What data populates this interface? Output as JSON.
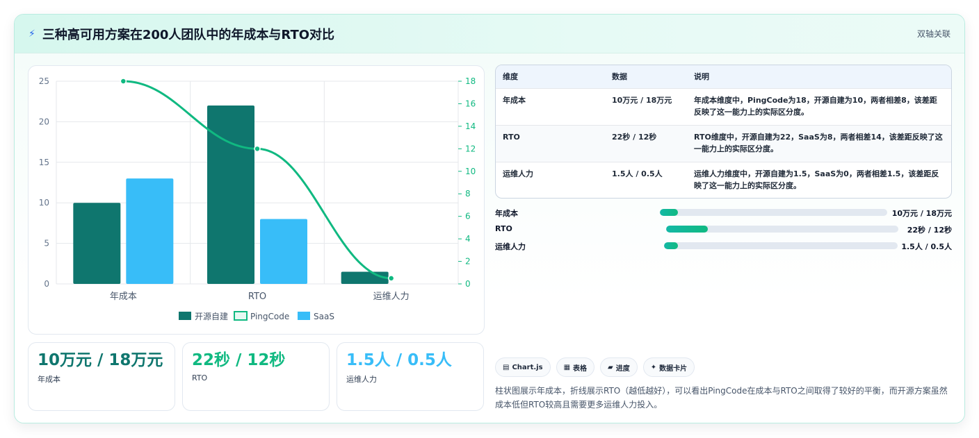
{
  "header": {
    "icon": "lightning-icon",
    "title": "三种高可用方案在200人团队中的年成本与RTO对比",
    "link": "双轴关联"
  },
  "colors": {
    "open_source": "#0f766e",
    "pingcode": "#10b981",
    "saas": "#38bdf8"
  },
  "chart_data": {
    "type": "bar",
    "categories": [
      "年成本",
      "RTO",
      "运维人力"
    ],
    "series": [
      {
        "name": "开源自建",
        "kind": "bar",
        "axis": "left",
        "values": [
          10,
          22,
          1.5
        ]
      },
      {
        "name": "PingCode",
        "kind": "line",
        "axis": "right",
        "values": [
          18,
          12,
          0.5
        ]
      },
      {
        "name": "SaaS",
        "kind": "bar",
        "axis": "left",
        "values": [
          13,
          8,
          0
        ]
      }
    ],
    "y_left": {
      "range": [
        0,
        25
      ],
      "ticks": [
        "0",
        "5",
        "10",
        "15",
        "20",
        "25"
      ]
    },
    "y_right": {
      "range": [
        0,
        18
      ],
      "ticks": [
        "0",
        "2",
        "4",
        "6",
        "8",
        "10",
        "12",
        "14",
        "16",
        "18"
      ]
    },
    "grid": true,
    "legend": "bottom"
  },
  "table": {
    "headers": [
      "维度",
      "数据",
      "说明"
    ],
    "rows": [
      {
        "dim": "年成本",
        "data": "10万元 / 18万元",
        "note": "年成本维度中，PingCode为18，开源自建为10，两者相差8，该差距反映了这一能力上的实际区分度。"
      },
      {
        "dim": "RTO",
        "data": "22秒 / 12秒",
        "note": "RTO维度中，开源自建为22，SaaS为8，两者相差14，该差距反映了这一能力上的实际区分度。"
      },
      {
        "dim": "运维人力",
        "data": "1.5人 / 0.5人",
        "note": "运维人力维度中，开源自建为1.5，SaaS为0，两者相差1.5，该差距反映了这一能力上的实际区分度。"
      }
    ]
  },
  "progress": [
    {
      "label": "年成本",
      "value": "10万元 / 18万元",
      "fill": 0.08
    },
    {
      "label": "RTO",
      "value": "22秒 / 12秒",
      "fill": 0.18
    },
    {
      "label": "运维人力",
      "value": "1.5人 / 0.5人",
      "fill": 0.06
    }
  ],
  "stats": [
    {
      "value": "10万元 / 18万元",
      "label": "年成本",
      "color": "#0f766e"
    },
    {
      "value": "22秒 / 12秒",
      "label": "RTO",
      "color": "#10b981"
    },
    {
      "value": "1.5人 / 0.5人",
      "label": "运维人力",
      "color": "#38bdf8"
    }
  ],
  "tags": [
    {
      "icon": "chart-icon",
      "glyph": "▤",
      "label": "Chart.js"
    },
    {
      "icon": "table-icon",
      "glyph": "▦",
      "label": "表格"
    },
    {
      "icon": "progress-icon",
      "glyph": "▰",
      "label": "进度"
    },
    {
      "icon": "sparkle-icon",
      "glyph": "✦",
      "label": "数据卡片"
    }
  ],
  "description": "柱状图展示年成本，折线展示RTO（越低越好），可以看出PingCode在成本与RTO之间取得了较好的平衡，而开源方案虽然成本低但RTO较高且需要更多运维人力投入。"
}
